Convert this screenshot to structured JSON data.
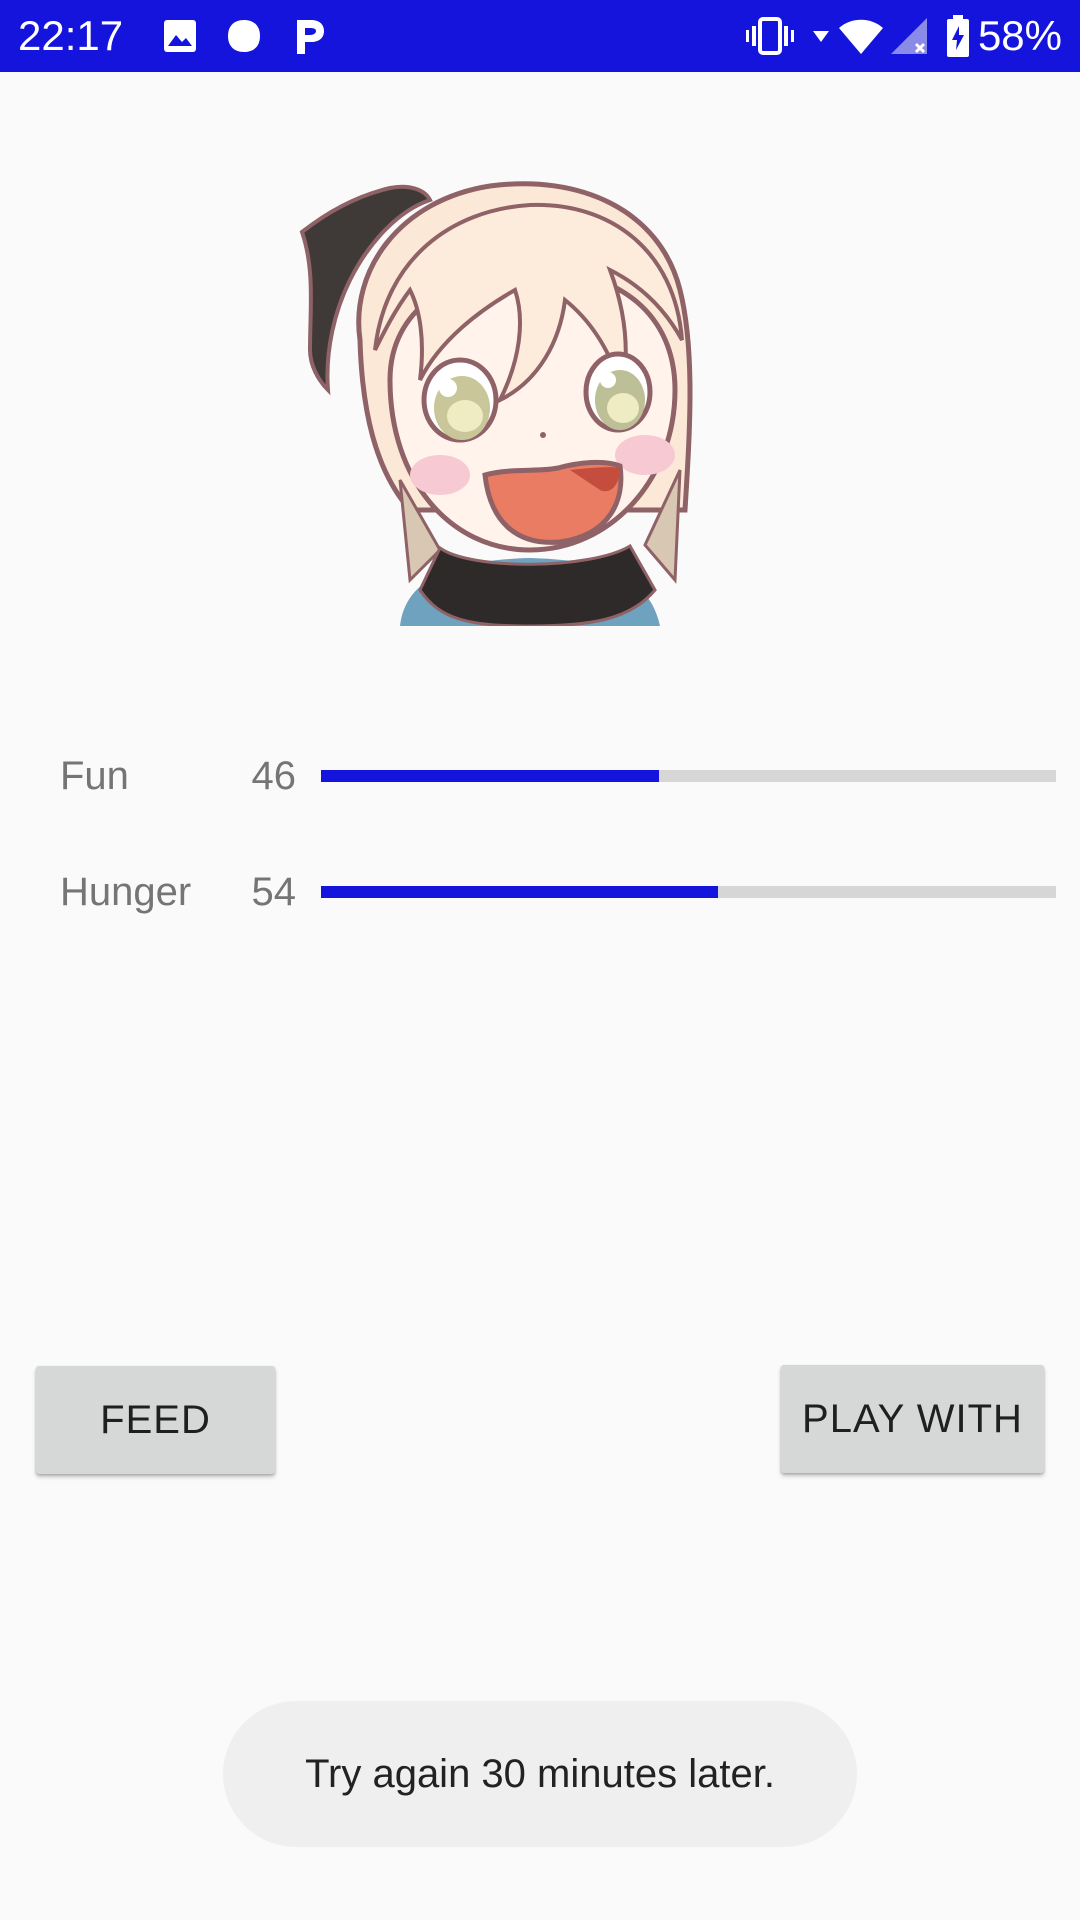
{
  "status_bar": {
    "time": "22:17",
    "battery_percent": "58%",
    "background_color": "#1414DC",
    "icons_left": [
      "image-icon",
      "circle-notification-icon",
      "p-notification-icon"
    ],
    "icons_right": [
      "vibrate-icon",
      "data-arrow-icon",
      "wifi-icon",
      "cell-signal-icon",
      "battery-icon"
    ]
  },
  "character": {
    "icon": "anime-girl-pet-image"
  },
  "stats": [
    {
      "label": "Fun",
      "value": "46",
      "level": 0.46
    },
    {
      "label": "Hunger",
      "value": "54",
      "level": 0.54
    }
  ],
  "buttons": {
    "feed": "FEED",
    "play_with": "PLAY WITH"
  },
  "toast": {
    "message": "Try again 30 minutes later."
  },
  "colors": {
    "accent": "#1414DC",
    "track": "#D6D6D6",
    "button_bg": "#D6D7D7",
    "page_bg": "#FAFAFA"
  }
}
